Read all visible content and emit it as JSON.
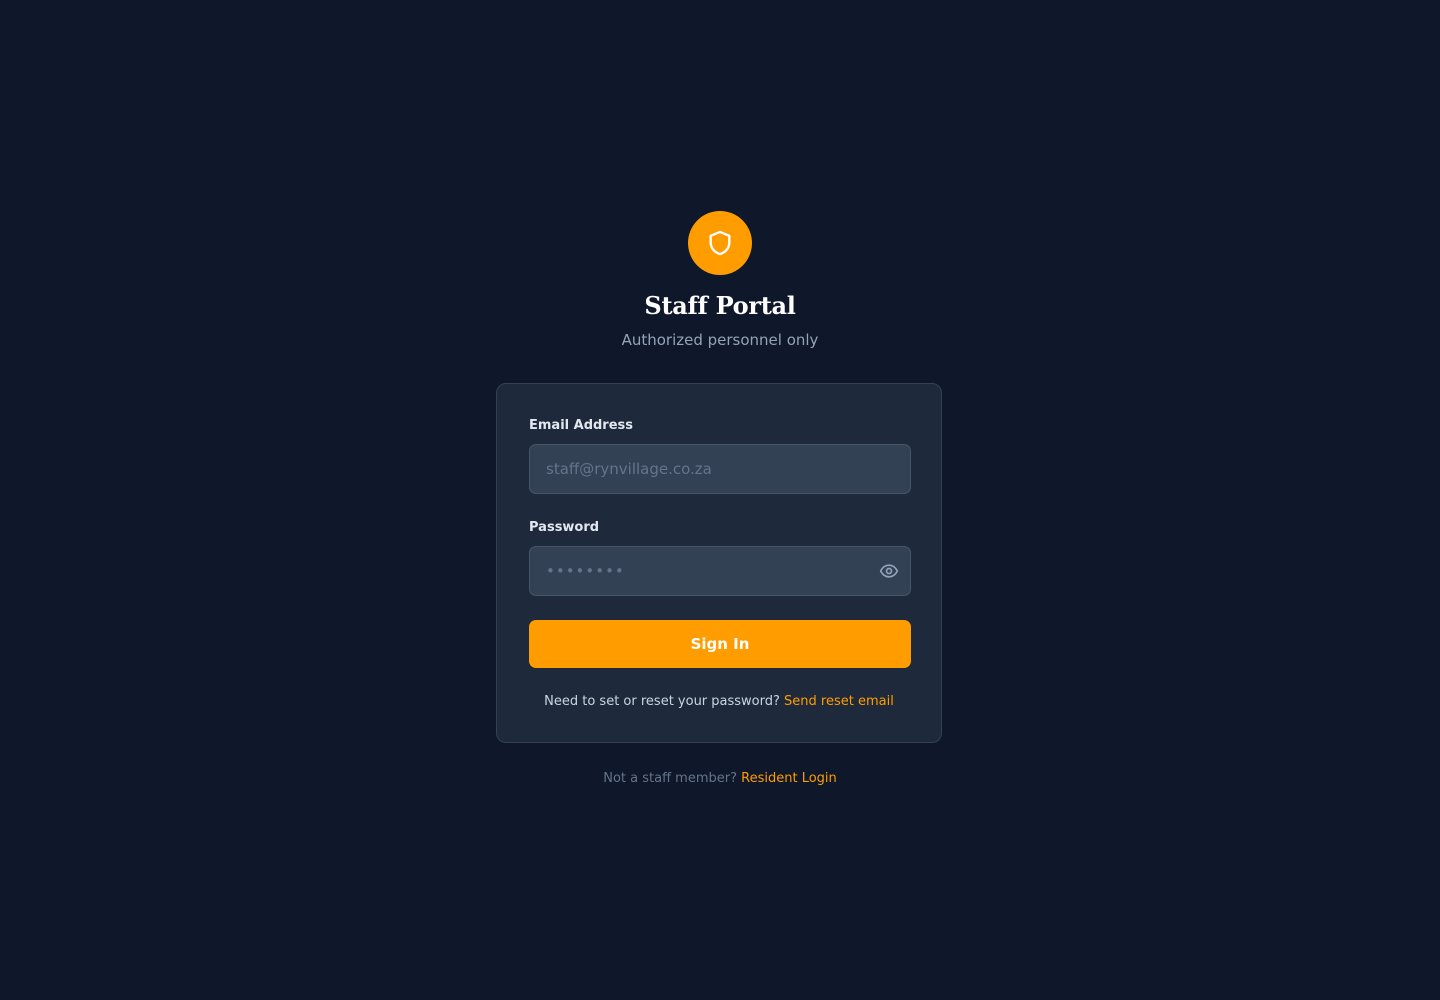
{
  "header": {
    "logo_icon": "shield-icon",
    "title": "Staff Portal",
    "subtitle": "Authorized personnel only"
  },
  "form": {
    "email_label": "Email Address",
    "email_placeholder": "staff@rynvillage.co.za",
    "email_value": "",
    "password_label": "Password",
    "password_placeholder": "••••••••",
    "password_value": "",
    "password_toggle_icon": "eye-icon",
    "submit_label": "Sign In",
    "reset_prompt": "Need to set or reset your password?",
    "reset_link": "Send reset email"
  },
  "footer": {
    "prompt": "Not a staff member?",
    "link": "Resident Login"
  },
  "colors": {
    "background": "#0f172a",
    "card": "#1e293b",
    "input": "#334155",
    "accent": "#ff9d00"
  }
}
